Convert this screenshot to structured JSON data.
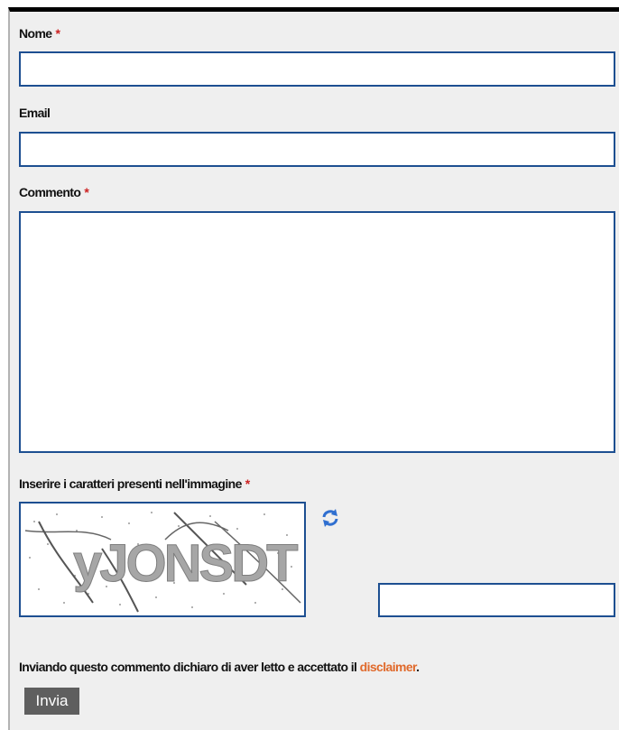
{
  "form": {
    "name_label": "Nome",
    "email_label": "Email",
    "comment_label": "Commento",
    "captcha_label": "Inserire i caratteri presenti nell'immagine",
    "required_mark": "*",
    "captcha_text": "yJONSDT",
    "disclaimer_prefix": "Inviando questo commento dichiaro di aver letto e accettato il ",
    "disclaimer_link": "disclaimer",
    "disclaimer_suffix": ".",
    "submit_label": "Invia"
  },
  "colors": {
    "field_border": "#1d4f91",
    "accent_link": "#e06a2c",
    "required": "#cc2222",
    "button_bg": "#5f5f5f"
  }
}
